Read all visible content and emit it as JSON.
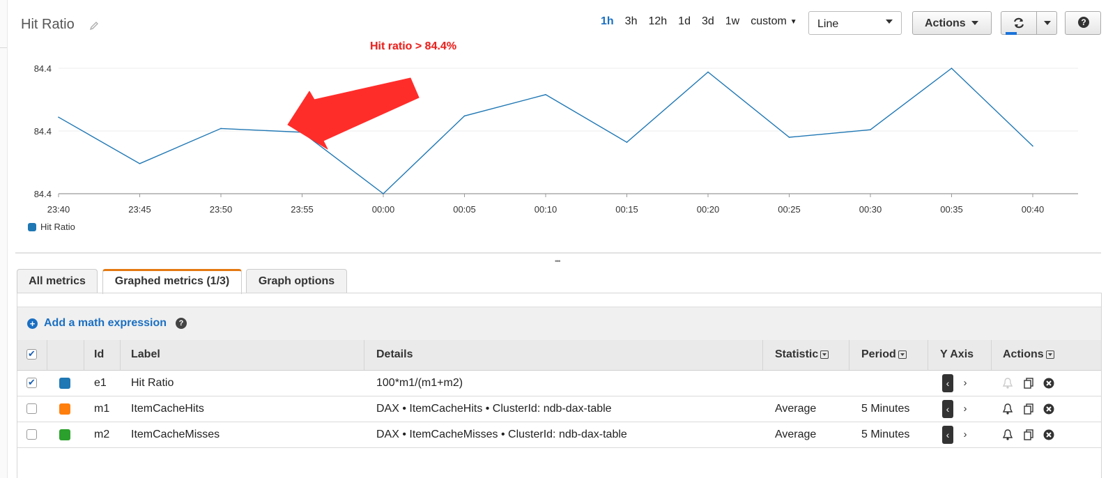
{
  "header": {
    "title": "Hit Ratio",
    "ranges": [
      "1h",
      "3h",
      "12h",
      "1d",
      "3d",
      "1w"
    ],
    "active_range": "1h",
    "custom_label": "custom",
    "chart_type_value": "Line",
    "actions_label": "Actions"
  },
  "annotation": {
    "text": "Hit ratio > 84.4%"
  },
  "chart_data": {
    "type": "line",
    "x": [
      "23:40",
      "23:45",
      "23:50",
      "23:55",
      "00:00",
      "00:05",
      "00:10",
      "00:15",
      "00:20",
      "00:25",
      "00:30",
      "00:35",
      "00:40"
    ],
    "y_tick_labels": [
      "84.4",
      "84.4",
      "84.4"
    ],
    "series": [
      {
        "name": "Hit Ratio",
        "color": "#1f77b4",
        "values_rel": [
          0.61,
          0.24,
          0.52,
          0.49,
          0.0,
          0.62,
          0.79,
          0.41,
          0.97,
          0.45,
          0.51,
          1.0,
          0.38
        ]
      }
    ],
    "grid": true,
    "legend_position": "bottom-left"
  },
  "legend": {
    "label": "Hit Ratio"
  },
  "tabs": {
    "all": "All metrics",
    "graphed": "Graphed metrics (1/3)",
    "options": "Graph options"
  },
  "toolbar": {
    "add_expression": "Add a math expression"
  },
  "table": {
    "headers": {
      "id": "Id",
      "label": "Label",
      "details": "Details",
      "statistic": "Statistic",
      "period": "Period",
      "yaxis": "Y Axis",
      "actions": "Actions"
    },
    "rows": [
      {
        "checked": true,
        "color": "#1f77b4",
        "id": "e1",
        "label": "Hit Ratio",
        "details": "100*m1/(m1+m2)",
        "statistic": "",
        "period": ""
      },
      {
        "checked": false,
        "color": "#ff7f0e",
        "id": "m1",
        "label": "ItemCacheHits",
        "details": "DAX • ItemCacheHits • ClusterId: ndb-dax-table",
        "statistic": "Average",
        "period": "5 Minutes"
      },
      {
        "checked": false,
        "color": "#2ca02c",
        "id": "m2",
        "label": "ItemCacheMisses",
        "details": "DAX • ItemCacheMisses • ClusterId: ndb-dax-table",
        "statistic": "Average",
        "period": "5 Minutes"
      }
    ]
  }
}
